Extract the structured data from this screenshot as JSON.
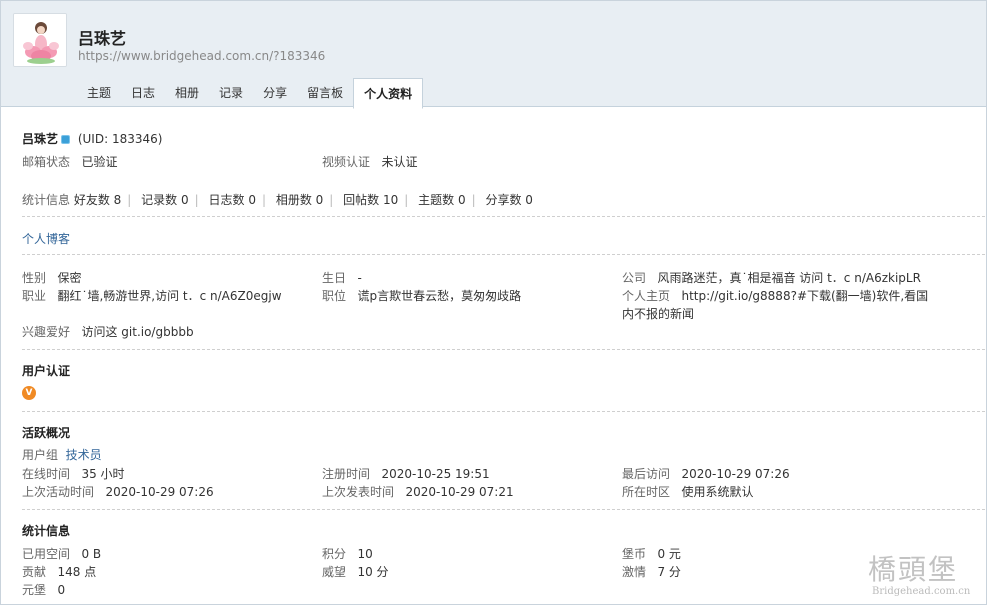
{
  "profile": {
    "name": "吕珠艺",
    "url": "https://www.bridgehead.com.cn/?183346",
    "uid_text": "(UID: 183346)"
  },
  "tabs": [
    {
      "label": "主题"
    },
    {
      "label": "日志"
    },
    {
      "label": "相册"
    },
    {
      "label": "记录"
    },
    {
      "label": "分享"
    },
    {
      "label": "留言板"
    },
    {
      "label": "个人资料",
      "active": true
    }
  ],
  "verify": {
    "email_label": "邮箱状态",
    "email_value": "已验证",
    "video_label": "视频认证",
    "video_value": "未认证"
  },
  "stats": {
    "label": "统计信息",
    "friends": "好友数 8",
    "records": "记录数 0",
    "blogs": "日志数 0",
    "albums": "相册数 0",
    "replies": "回帖数 10",
    "threads": "主题数 0",
    "shares": "分享数 0"
  },
  "blog_link": "个人博客",
  "personal": {
    "gender_label": "性别",
    "gender_value": "保密",
    "birthday_label": "生日",
    "birthday_value": "-",
    "company_label": "公司",
    "company_value": "风雨路迷茫，真˙相是福音 访问 t．c n/A6zkipLR",
    "job_label": "职业",
    "job_value": "翻红˙墙,畅游世界,访问 t．c n/A6Z0egjw",
    "position_label": "职位",
    "position_value": "谎p言欺世春云愁，莫匆匆歧路",
    "homepage_label": "个人主页",
    "homepage_value_1": "http://git.io/g8888?#下载(翻一墙)软件,看国",
    "homepage_value_2": "内不报的新闻",
    "hobby_label": "兴趣爱好",
    "hobby_value": "访问这 git.io/gbbbb"
  },
  "auth": {
    "title": "用户认证",
    "badge": "V"
  },
  "activity": {
    "title": "活跃概况",
    "group_label": "用户组",
    "group_value": "技术员",
    "online_label": "在线时间",
    "online_value": "35 小时",
    "register_label": "注册时间",
    "register_value": "2020-10-25 19:51",
    "lastvisit_label": "最后访问",
    "lastvisit_value": "2020-10-29 07:26",
    "lastactive_label": "上次活动时间",
    "lastactive_value": "2020-10-29 07:26",
    "lastpost_label": "上次发表时间",
    "lastpost_value": "2020-10-29 07:21",
    "timezone_label": "所在时区",
    "timezone_value": "使用系统默认"
  },
  "credits": {
    "title": "统计信息",
    "space_label": "已用空间",
    "space_value": "0 B",
    "points_label": "积分",
    "points_value": "10",
    "coin_label": "堡币",
    "coin_value": "0 元",
    "contrib_label": "贡献",
    "contrib_value": "148 点",
    "prestige_label": "威望",
    "prestige_value": "10 分",
    "passion_label": "激情",
    "passion_value": "7 分",
    "yuanbao_label": "元堡",
    "yuanbao_value": "0"
  },
  "watermark": {
    "logo": "橋頭堡",
    "url": "Bridgehead.com.cn"
  },
  "colors": {
    "header_bg": "#e8eef3",
    "link": "#336699",
    "badge_orange": "#f08a24",
    "uid_badge": "#3ba0d8"
  }
}
